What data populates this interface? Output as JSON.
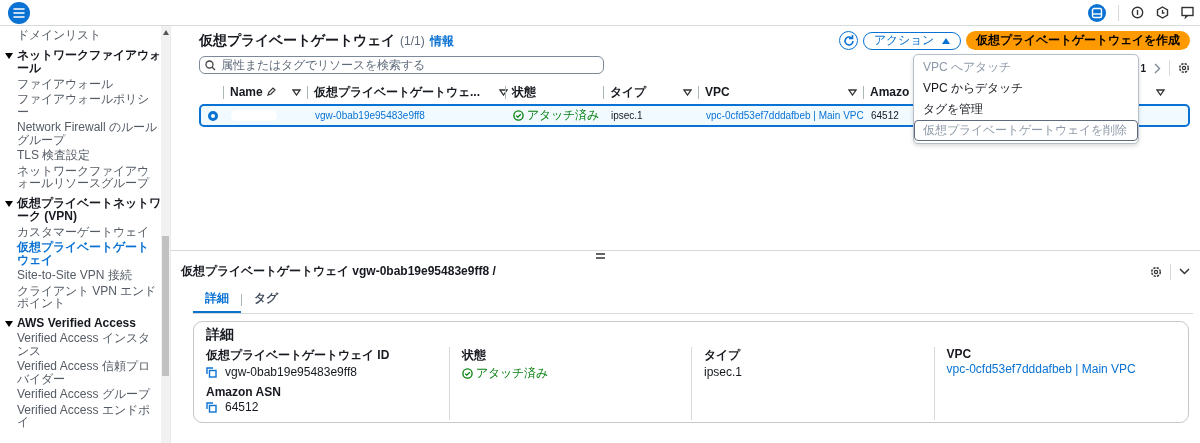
{
  "sidebar": {
    "items": [
      {
        "kind": "link",
        "label": "ドメインリスト",
        "selected": false
      },
      {
        "kind": "section",
        "label": "ネットワークファイアウォール",
        "expanded": true,
        "children": [
          {
            "label": "ファイアウォール",
            "selected": false
          },
          {
            "label": "ファイアウォールポリシー",
            "selected": false
          },
          {
            "label": "Network Firewall のルールグループ",
            "selected": false
          },
          {
            "label": "TLS 検査設定",
            "selected": false
          },
          {
            "label": "ネットワークファイアウォールリソースグループ",
            "selected": false
          }
        ]
      },
      {
        "kind": "section",
        "label": "仮想プライベートネットワーク (VPN)",
        "expanded": true,
        "children": [
          {
            "label": "カスタマーゲートウェイ",
            "selected": false
          },
          {
            "label": "仮想プライベートゲートウェイ",
            "selected": true
          },
          {
            "label": "Site-to-Site VPN 接続",
            "selected": false
          },
          {
            "label": "クライアント VPN エンドポイント",
            "selected": false
          }
        ]
      },
      {
        "kind": "section",
        "label": "AWS Verified Access",
        "expanded": true,
        "children": [
          {
            "label": "Verified Access インスタンス",
            "selected": false
          },
          {
            "label": "Verified Access 信頼プロバイダー",
            "selected": false
          },
          {
            "label": "Verified Access グループ",
            "selected": false
          },
          {
            "label": "Verified Access エンドポイ",
            "selected": false
          }
        ]
      }
    ]
  },
  "list": {
    "title": "仮想プライベートゲートウェイ",
    "count": "(1/1)",
    "info": "情報",
    "actions_button": "アクション",
    "create_button": "仮想プライベートゲートウェイを作成",
    "search": {
      "placeholder": "属性またはタグでリソースを検索する"
    },
    "page": "1",
    "actions_menu": [
      {
        "label": "VPC へアタッチ",
        "disabled": true,
        "focused": false
      },
      {
        "label": "VPC からデタッチ",
        "disabled": false,
        "focused": false
      },
      {
        "label": "タグを管理",
        "disabled": false,
        "focused": false
      },
      {
        "label": "仮想プライベートゲートウェイを削除",
        "disabled": true,
        "focused": true
      }
    ],
    "columns": [
      {
        "label": "Name",
        "editable": true,
        "filter": true
      },
      {
        "label": "仮想プライベートゲートウェ...",
        "editable": false,
        "filter": true
      },
      {
        "label": "状態",
        "editable": false,
        "filter": false
      },
      {
        "label": "タイプ",
        "editable": false,
        "filter": true
      },
      {
        "label": "VPC",
        "editable": false,
        "filter": true
      },
      {
        "label": "Amazo",
        "editable": false,
        "filter": true
      }
    ],
    "rows": [
      {
        "selected": true,
        "cells": [
          {
            "kind": "blurred"
          },
          {
            "kind": "link",
            "text": "vgw-0bab19e95483e9ff8"
          },
          {
            "kind": "status",
            "text": "アタッチ済み"
          },
          {
            "kind": "text",
            "text": "ipsec.1"
          },
          {
            "kind": "link",
            "text": "vpc-0cfd53ef7dddafbeb | Main VPC"
          },
          {
            "kind": "text",
            "text": "64512"
          }
        ]
      }
    ]
  },
  "detail": {
    "title": "仮想プライベートゲートウェイ vgw-0bab19e95483e9ff8 /",
    "tabs": [
      {
        "label": "詳細",
        "selected": true
      },
      {
        "label": "タグ",
        "selected": false
      }
    ],
    "card_title": "詳細",
    "columns": [
      [
        {
          "label": "仮想プライベートゲートウェイ ID",
          "kind": "copy",
          "value": "vgw-0bab19e95483e9ff8"
        },
        {
          "label": "Amazon ASN",
          "kind": "copy",
          "value": "64512"
        }
      ],
      [
        {
          "label": "状態",
          "kind": "status",
          "value": "アタッチ済み"
        }
      ],
      [
        {
          "label": "タイプ",
          "kind": "text",
          "value": "ipsec.1"
        }
      ],
      [
        {
          "label": "VPC",
          "kind": "link",
          "value": "vpc-0cfd53ef7dddafbeb | Main VPC"
        }
      ]
    ]
  }
}
